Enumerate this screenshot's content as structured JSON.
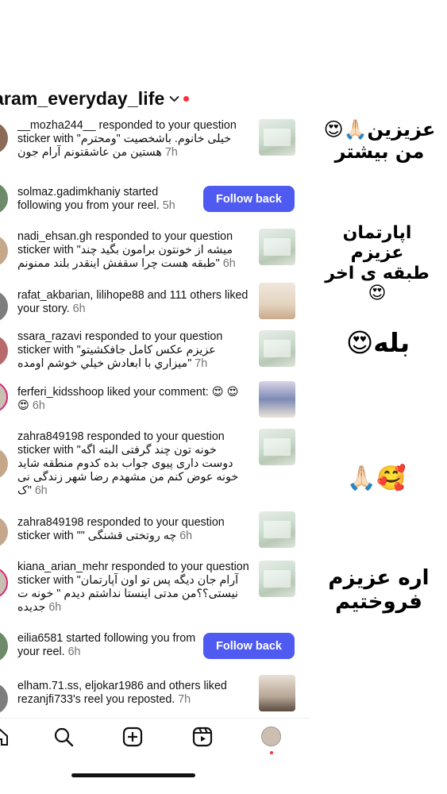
{
  "header": {
    "username": "aram_everyday_life"
  },
  "notifications": [
    {
      "user": "__mozha244__",
      "text": " responded to your question sticker with \"",
      "quote": "خیلی خانوم. باشخصیت \"ومحترم هستین من عاشقتونم آرام جون",
      "time": "7h"
    },
    {
      "user": "solmaz.gadimkhaniy",
      "text": " started following you from your reel.",
      "time": "5h",
      "button": "Follow back"
    },
    {
      "user": "nadi_ehsan.gh",
      "text": " responded to your question sticker with \"",
      "quote": "میشه از خونتون برامون بگید چند \"طبقه هست چرا سقفش اینقدر بلند ممنونم",
      "time": "6h"
    },
    {
      "user": "rafat_akbarian, lilihope88",
      "text": " and 111 others liked your story.",
      "time": "6h"
    },
    {
      "user": "ssara_razavi",
      "text": " responded to your question sticker with \"",
      "quote": "عزیزم عکس کامل جافکشیتو \"ميزاري با ابعادش خيلي خوشم اومده",
      "time": "7h"
    },
    {
      "user": "ferferi_kidsshoop",
      "text": " liked your comment: 😍 😍😍",
      "time": "6h"
    },
    {
      "user": "zahra849198",
      "text": " responded to your question sticker with \"",
      "quote": "خونه تون چند گرفتی البته اگه دوست داری پیوی جواب بده کدوم منطقه شاید خونه عوض کنم من مشهدم رضا شهر زندگی نی \"ک",
      "time": "6h"
    },
    {
      "user": "zahra849198",
      "text": " responded to your question sticker with \"",
      "quote": "چه روتختی قشنگی \"",
      "time": "6h"
    },
    {
      "user": "kiana_arian_mehr",
      "text": " responded to your question sticker with \"",
      "quote": "آرام جان دیگه پس تو اون آپارتمان نیستی؟؟من مدتی اینستا نداشتم  دیدم \" خونه ت جدیده",
      "time": "6h"
    },
    {
      "user": "eilia6581",
      "text": " started following you from your reel.",
      "time": "6h",
      "button": "Follow back"
    },
    {
      "user": "elham.71.ss, eljokar1986",
      "text": " and others liked rezanjfi733's reel you reposted.",
      "time": "7h"
    }
  ],
  "stickers": {
    "s1": "عزیزین🙏🏻😍\nمن بیشتر",
    "s2": "اپارتمان عزیزم\nطبقه ی اخر😍",
    "s3": "بله😍",
    "s4": "🥰🙏🏻",
    "s5": "اره عزیزم\nفروختیم"
  },
  "colors": {
    "accent": "#4f5bf0",
    "notification_dot": "#ff2d3c"
  }
}
